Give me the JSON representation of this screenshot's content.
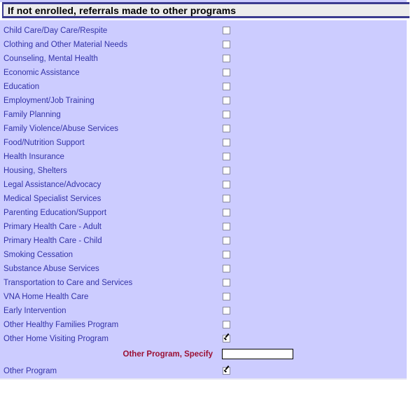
{
  "header": {
    "title": "If not enrolled, referrals made to other programs"
  },
  "colors": {
    "panel_background": "#ccccff",
    "header_background": "#ececec",
    "header_border": "#3b3b8f",
    "label_text": "#3333a8",
    "specify_label_text": "#9b1033"
  },
  "referrals": [
    {
      "label": "Child Care/Day Care/Respite",
      "checked": false
    },
    {
      "label": "Clothing and Other Material Needs",
      "checked": false
    },
    {
      "label": "Counseling, Mental Health",
      "checked": false
    },
    {
      "label": "Economic Assistance",
      "checked": false
    },
    {
      "label": "Education",
      "checked": false
    },
    {
      "label": "Employment/Job Training",
      "checked": false
    },
    {
      "label": "Family Planning",
      "checked": false
    },
    {
      "label": "Family Violence/Abuse Services",
      "checked": false
    },
    {
      "label": "Food/Nutrition Support",
      "checked": false
    },
    {
      "label": "Health Insurance",
      "checked": false
    },
    {
      "label": "Housing, Shelters",
      "checked": false
    },
    {
      "label": "Legal Assistance/Advocacy",
      "checked": false
    },
    {
      "label": "Medical Specialist Services",
      "checked": false
    },
    {
      "label": "Parenting Education/Support",
      "checked": false
    },
    {
      "label": "Primary Health Care - Adult",
      "checked": false
    },
    {
      "label": "Primary Health Care - Child",
      "checked": false
    },
    {
      "label": "Smoking Cessation",
      "checked": false
    },
    {
      "label": "Substance Abuse Services",
      "checked": false
    },
    {
      "label": "Transportation to Care and Services",
      "checked": false
    },
    {
      "label": "VNA Home Health Care",
      "checked": false
    },
    {
      "label": "Early Intervention",
      "checked": false
    },
    {
      "label": "Other Healthy Families Program",
      "checked": false
    },
    {
      "label": "Other Home Visiting Program",
      "checked": true
    }
  ],
  "specify_fields": [
    {
      "label": "Other Program, Specify",
      "value": "",
      "placeholder": ""
    },
    {
      "label": "Other Program, Specify",
      "value": "",
      "placeholder": ""
    }
  ],
  "other_program": {
    "label": "Other Program",
    "checked": true
  }
}
